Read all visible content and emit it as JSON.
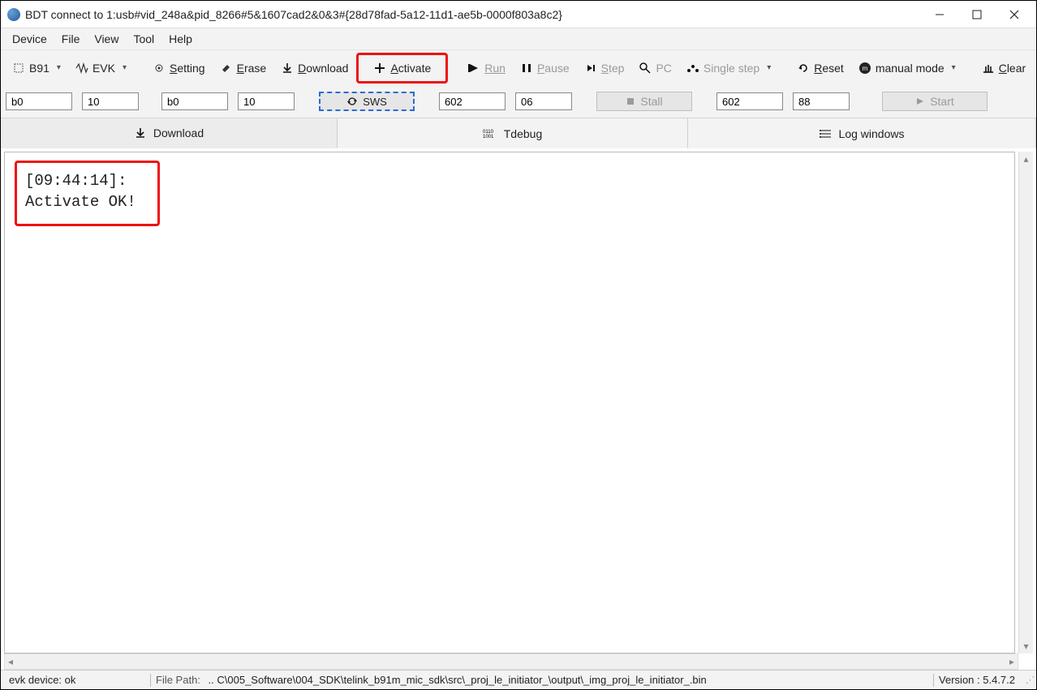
{
  "title": "BDT connect to 1:usb#vid_248a&pid_8266#5&1607cad2&0&3#{28d78fad-5a12-11d1-ae5b-0000f803a8c2}",
  "menu": {
    "device": "Device",
    "file": "File",
    "view": "View",
    "tool": "Tool",
    "help": "Help"
  },
  "toolbar": {
    "chip": "B91",
    "board": "EVK",
    "setting": "Setting",
    "erase": "Erase",
    "download": "Download",
    "activate": "Activate",
    "run": "Run",
    "pause": "Pause",
    "step": "Step",
    "pc": "PC",
    "singlestep": "Single step",
    "reset": "Reset",
    "mode": "manual mode",
    "clear": "Clear"
  },
  "toolbar2": {
    "in1": "b0",
    "in2": "10",
    "in3": "b0",
    "in4": "10",
    "sws": "SWS",
    "in5": "602",
    "in6": "06",
    "stall": "Stall",
    "in7": "602",
    "in8": "88",
    "start": "Start"
  },
  "tabs": {
    "download": "Download",
    "tdebug": "Tdebug",
    "log": "Log windows"
  },
  "log": {
    "line1": "[09:44:14]:",
    "line2": "Activate OK!"
  },
  "status": {
    "device": "evk device: ok",
    "pathlabel": "File Path:",
    "path": ".. C\\005_Software\\004_SDK\\telink_b91m_mic_sdk\\src\\_proj_le_initiator_\\output\\_img_proj_le_initiator_.bin",
    "version": "Version : 5.4.7.2"
  }
}
